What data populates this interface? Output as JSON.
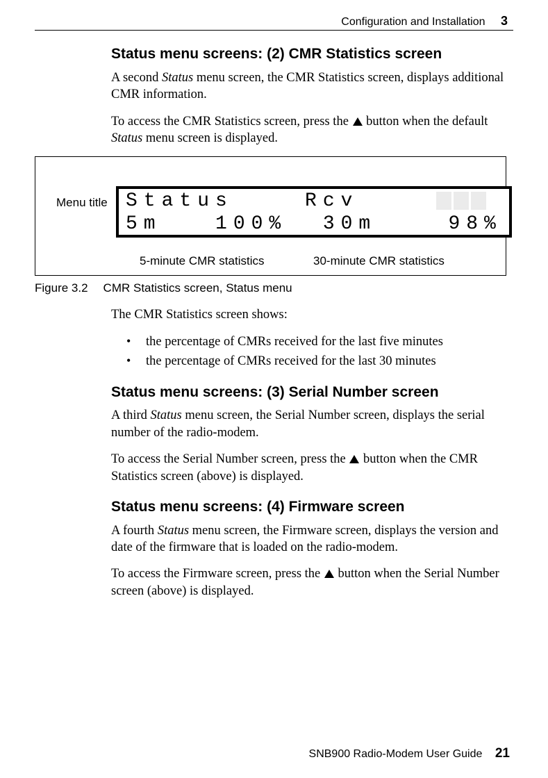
{
  "header": {
    "section": "Configuration and Installation",
    "chapter_number": "3"
  },
  "section1": {
    "heading": "Status menu screens: (2) CMR Statistics screen",
    "para1_a": "A second ",
    "para1_b": "Status",
    "para1_c": " menu screen, the CMR Statistics screen, displays additional CMR information.",
    "para2_a": "To access the CMR Statistics screen, press the ",
    "para2_b": " button when the default ",
    "para2_c": "Status",
    "para2_d": " menu screen is displayed."
  },
  "figure": {
    "menu_title_label": "Menu title",
    "lcd_line1": "Status    Rcv",
    "lcd_line2": "5m   100%  30m    98%",
    "callout_left": "5-minute CMR statistics",
    "callout_right": "30-minute CMR statistics",
    "caption_num": "Figure 3.2",
    "caption_text": "CMR Statistics screen, Status menu"
  },
  "after_fig": {
    "intro": "The CMR Statistics screen shows:",
    "bullets": [
      "the percentage of CMRs received for the last five minutes",
      "the percentage of CMRs received for the last 30 minutes"
    ]
  },
  "section2": {
    "heading": "Status menu screens: (3) Serial Number screen",
    "para1_a": "A third ",
    "para1_b": "Status",
    "para1_c": " menu screen, the Serial Number screen, displays the serial number of the radio-modem.",
    "para2_a": "To access the Serial Number screen, press the ",
    "para2_b": " button when the CMR Statistics screen (above) is displayed."
  },
  "section3": {
    "heading": "Status menu screens: (4) Firmware screen",
    "para1_a": "A fourth ",
    "para1_b": "Status",
    "para1_c": " menu screen, the Firmware screen, displays the version and date of the firmware that is loaded on the radio-modem.",
    "para2_a": "To access the Firmware screen, press the ",
    "para2_b": " button when the Serial Number screen (above) is displayed."
  },
  "footer": {
    "title": "SNB900 Radio-Modem User Guide",
    "page": "21"
  }
}
